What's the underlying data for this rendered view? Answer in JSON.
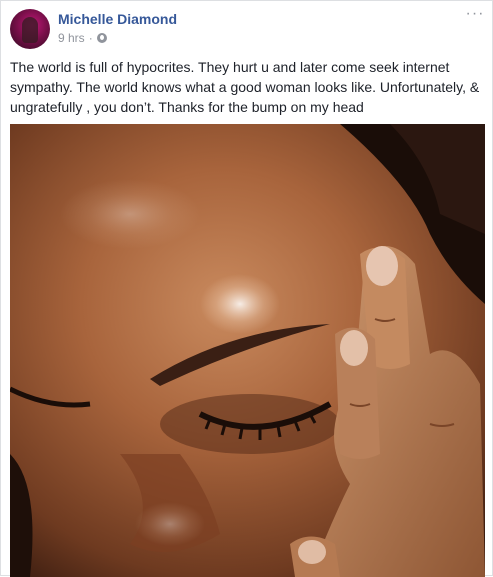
{
  "post": {
    "author": "Michelle Diamond",
    "time": "9 hrs",
    "separator": "·",
    "privacy_icon": "globe-icon",
    "more_icon": "more-options-icon",
    "more_label": "···",
    "text": "The world is full of hypocrites. They hurt u and later come seek internet sympathy. The world knows what a good woman looks like. Unfortunately, & ungratefully , you don’t. Thanks for the bump on my head",
    "photo_icon": "photo-image",
    "colors": {
      "author": "#365899",
      "meta": "#90949c",
      "text": "#1d2129",
      "border": "#dddfe2"
    }
  }
}
